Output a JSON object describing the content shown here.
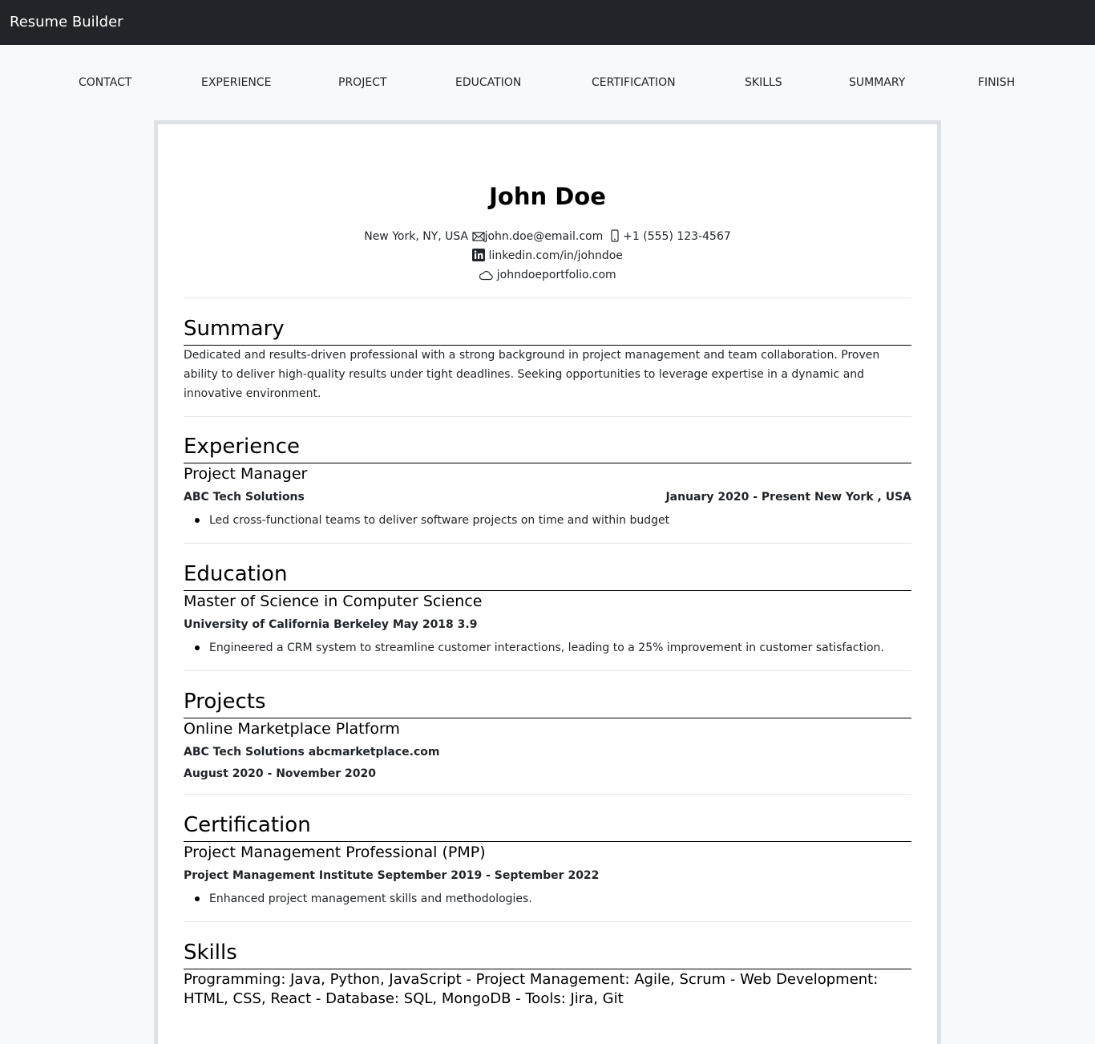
{
  "app": {
    "brand": "Resume Builder"
  },
  "steps": [
    "CONTACT",
    "EXPERIENCE",
    "PROJECT",
    "EDUCATION",
    "CERTIFICATION",
    "SKILLS",
    "SUMMARY",
    "FINISH"
  ],
  "resume": {
    "name": "John Doe",
    "contact": {
      "location": "New York, NY, USA",
      "email": "john.doe@email.com",
      "phone": "+1 (555) 123-4567",
      "linkedin": "linkedin.com/in/johndoe",
      "portfolio": "johndoeportfolio.com"
    },
    "summary": {
      "title": "Summary",
      "text": "Dedicated and results-driven professional with a strong background in project management and team collaboration. Proven ability to deliver high-quality results under tight deadlines. Seeking opportunities to leverage expertise in a dynamic and innovative environment."
    },
    "experience": {
      "title": "Experience",
      "role": "Project Manager",
      "company": "ABC Tech Solutions",
      "dates_location": "January 2020 - Present New York , USA",
      "bullet": "Led cross-functional teams to deliver software projects on time and within budget"
    },
    "education": {
      "title": "Education",
      "degree": "Master of Science in Computer Science",
      "details": "University of California Berkeley May 2018 3.9",
      "bullet": "Engineered a CRM system to streamline customer interactions, leading to a 25% improvement in customer satisfaction."
    },
    "projects": {
      "title": "Projects",
      "name": "Online Marketplace Platform",
      "org": "ABC Tech Solutions abcmarketplace.com",
      "dates": "August 2020 - November 2020"
    },
    "certification": {
      "title": "Certification",
      "name": "Project Management Professional (PMP)",
      "details": "Project Management Institute September 2019 - September 2022",
      "bullet": "Enhanced project management skills and methodologies."
    },
    "skills": {
      "title": "Skills",
      "text": "Programming: Java, Python, JavaScript - Project Management: Agile, Scrum - Web Development: HTML, CSS, React - Database: SQL, MongoDB - Tools: Jira, Git"
    }
  }
}
